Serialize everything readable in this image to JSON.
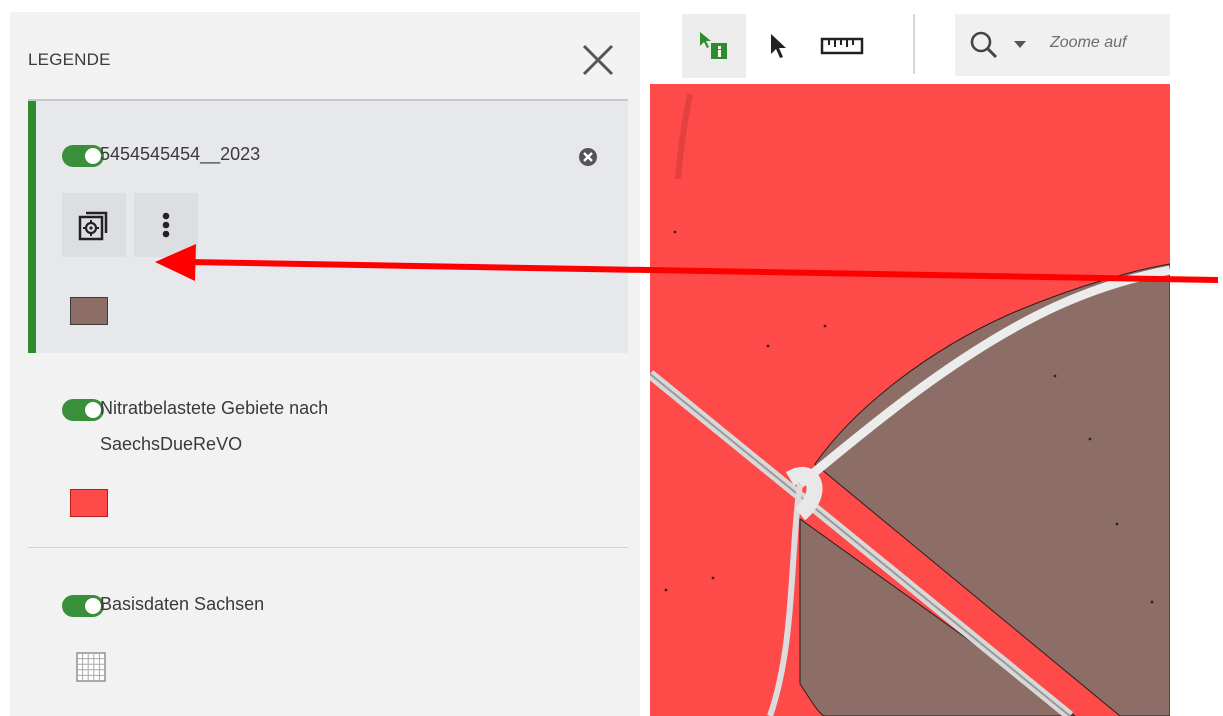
{
  "legend": {
    "title": "LEGENDE",
    "layers": [
      {
        "name": "5454545454__2023",
        "visible": true,
        "swatch_color": "#8d6e66",
        "selected": true
      },
      {
        "name": "Nitratbelastete Gebiete nach",
        "name_line2": "SaechsDueReVO",
        "visible": true,
        "swatch_color": "#ff4a4a"
      },
      {
        "name": "Basisdaten Sachsen",
        "visible": true,
        "swatch_icon": "grid-icon"
      }
    ]
  },
  "toolbar": {
    "tools": [
      "info-select-icon",
      "pointer-icon",
      "ruler-icon"
    ],
    "search_placeholder": "Zoome auf"
  },
  "colors": {
    "accent_green": "#2e8b2e",
    "toggle_green": "#3a8f3a",
    "map_red": "#ff4a4a",
    "map_brown": "#8d6e66",
    "annotation_arrow": "#ff0000"
  }
}
